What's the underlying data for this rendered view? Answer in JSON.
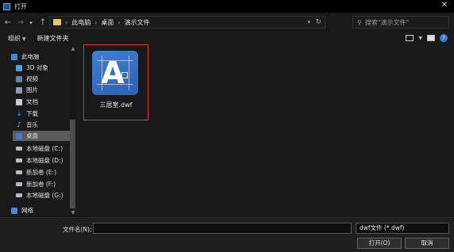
{
  "window": {
    "title": "打开",
    "close_glyph": "✕"
  },
  "nav": {
    "back": "←",
    "forward": "→",
    "dropdown": "▾",
    "up": "↑",
    "breadcrumb": [
      "此电脑",
      "桌面",
      "演示文件"
    ],
    "separator": "›",
    "refresh": "↻"
  },
  "search": {
    "placeholder": "搜索\"演示文件\"",
    "icon": "⚲"
  },
  "toolbar": {
    "organize_label": "组织",
    "new_folder_label": "新建文件夹"
  },
  "sidebar": {
    "items": [
      {
        "label": "此电脑",
        "icon": "pc-icon"
      },
      {
        "label": "3D 对象",
        "icon": "3d-objects-icon"
      },
      {
        "label": "视频",
        "icon": "video-icon"
      },
      {
        "label": "图片",
        "icon": "pictures-icon"
      },
      {
        "label": "文档",
        "icon": "documents-icon"
      },
      {
        "label": "下载",
        "icon": "download-icon"
      },
      {
        "label": "音乐",
        "icon": "music-icon"
      },
      {
        "label": "桌面",
        "icon": "desktop-icon",
        "selected": true
      },
      {
        "label": "本地磁盘 (C:)",
        "icon": "disk-icon"
      },
      {
        "label": "本地磁盘 (D:)",
        "icon": "disk-icon"
      },
      {
        "label": "新加卷 (E:)",
        "icon": "disk-icon"
      },
      {
        "label": "新加卷 (F:)",
        "icon": "disk-icon"
      },
      {
        "label": "本地磁盘 (G:)",
        "icon": "disk-icon"
      },
      {
        "label": "网络",
        "icon": "network-icon"
      }
    ]
  },
  "files": [
    {
      "name": "三居室.dwf",
      "icon": "dwf-file-icon",
      "icon_letter": "A",
      "selected": true
    }
  ],
  "bottom": {
    "filename_label": "文件名(N):",
    "filename_value": "",
    "filetype_value": "dwf文件 (*.dwf)",
    "open_label": "打开(O)",
    "cancel_label": "取消"
  },
  "colors": {
    "highlight_border": "#d23a3a",
    "background": "#191919",
    "accent": "#3c8dde"
  }
}
